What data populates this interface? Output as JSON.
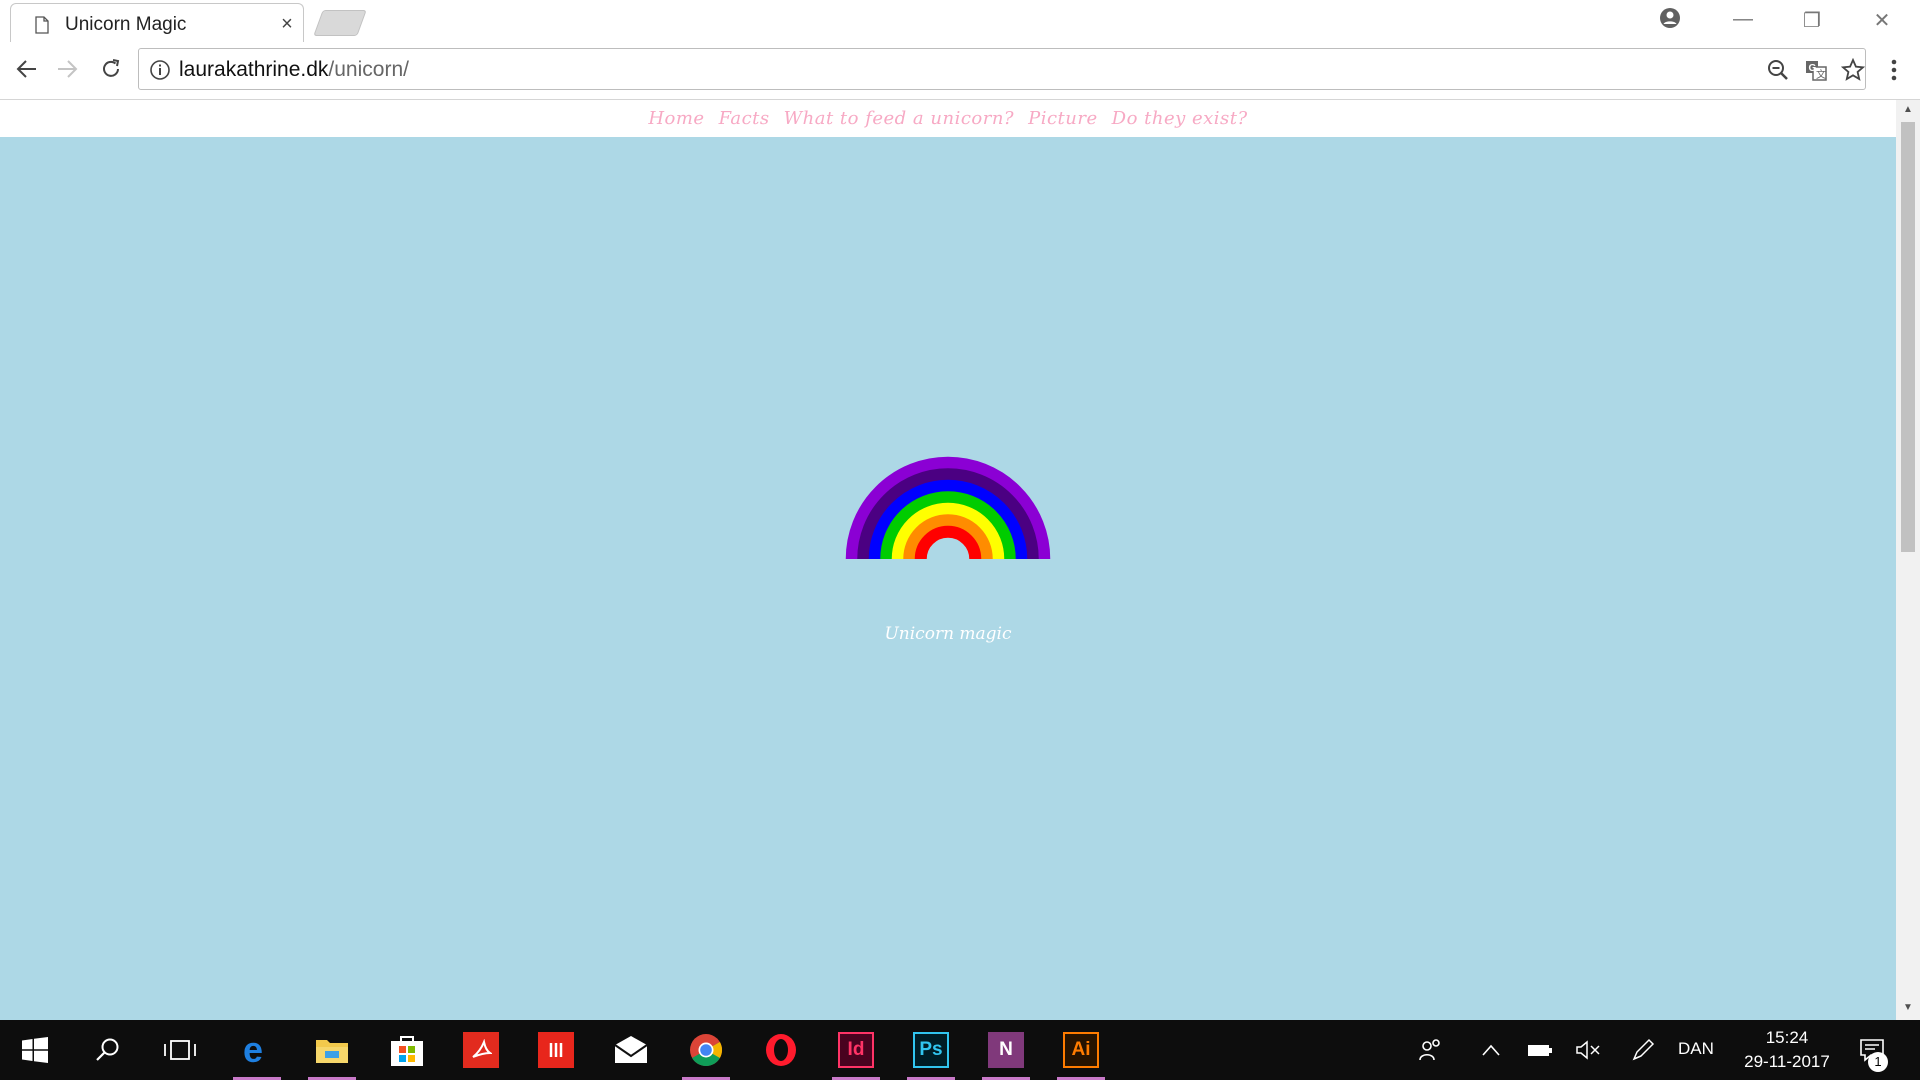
{
  "browser": {
    "tab_title": "Unicorn Magic",
    "tab_close": "×",
    "url_host": "laurakathrine.dk",
    "url_path": "/unicorn/",
    "window_controls": {
      "minimize": "—",
      "restore": "❐",
      "close": "✕"
    }
  },
  "page": {
    "nav": [
      "Home",
      "Facts",
      "What to feed a unicorn?",
      "Picture",
      "Do they exist?"
    ],
    "hero_text": "Unicorn magic",
    "background_color": "#add8e6",
    "nav_color": "#f7a9c4",
    "rainbow_colors": [
      "#8b00d4",
      "#4b0082",
      "#0000ff",
      "#00cc00",
      "#ffff00",
      "#ff8c00",
      "#ff0000"
    ]
  },
  "taskbar": {
    "apps": [
      "start-icon",
      "search-icon",
      "task-view-icon",
      "edge-icon",
      "file-explorer-icon",
      "store-icon",
      "acrobat-icon",
      "app-red-icon",
      "mail-icon",
      "chrome-icon",
      "opera-icon",
      "indesign-icon",
      "photoshop-icon",
      "onenote-icon",
      "illustrator-icon"
    ],
    "indesign_label": "Id",
    "photoshop_label": "Ps",
    "onenote_label": "N",
    "illustrator_label": "Ai",
    "language": "DAN",
    "time": "15:24",
    "date": "29-11-2017",
    "notification_count": "1"
  }
}
